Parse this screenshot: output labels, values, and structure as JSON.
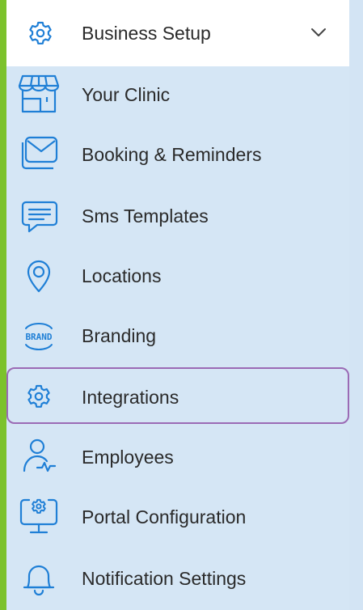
{
  "sidebar": {
    "header": {
      "label": "Business Setup",
      "icon": "gear-icon"
    },
    "items": [
      {
        "label": "Your Clinic",
        "icon": "storefront-icon"
      },
      {
        "label": "Booking & Reminders",
        "icon": "envelope-icon"
      },
      {
        "label": "Sms Templates",
        "icon": "chat-bubble-icon"
      },
      {
        "label": "Locations",
        "icon": "map-pin-icon"
      },
      {
        "label": "Branding",
        "icon": "brand-badge-icon",
        "badge_text": "BRAND"
      },
      {
        "label": "Integrations",
        "icon": "gear-icon",
        "selected": true
      },
      {
        "label": "Employees",
        "icon": "user-heartbeat-icon"
      },
      {
        "label": "Portal Configuration",
        "icon": "monitor-gear-icon"
      },
      {
        "label": "Notification Settings",
        "icon": "bell-icon"
      }
    ]
  },
  "colors": {
    "accent": "#7cc22c",
    "icon": "#1f7fd6",
    "selected_border": "#9b6bb5",
    "panel_bg": "#d5e6f5"
  }
}
